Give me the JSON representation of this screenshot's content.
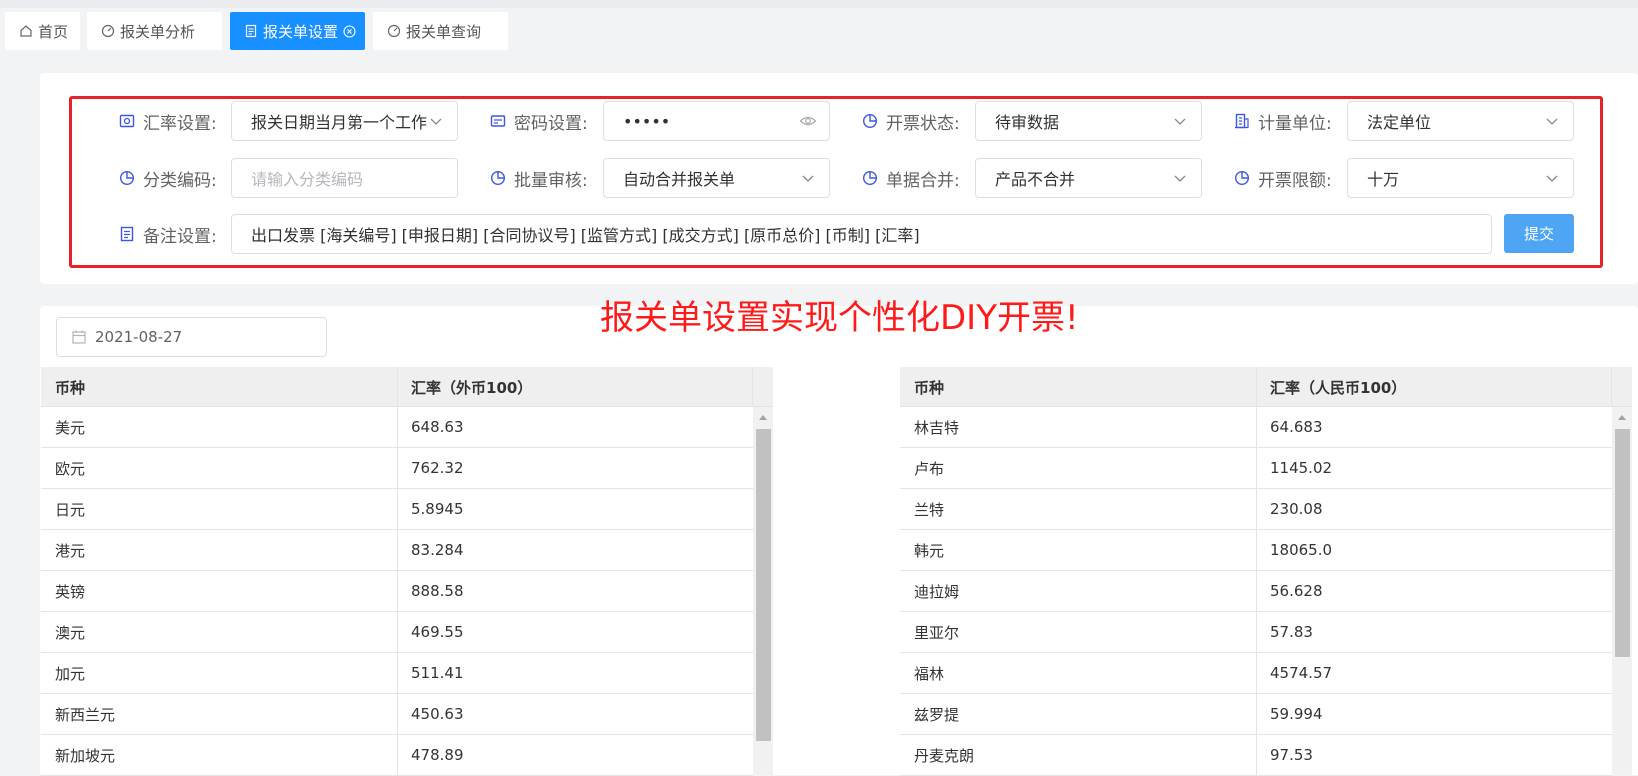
{
  "tabs": [
    {
      "label": "首页",
      "icon": "home-icon"
    },
    {
      "label": "报关单分析",
      "icon": "dashboard-icon"
    },
    {
      "label": "报关单设置",
      "icon": "document-icon",
      "active": true
    },
    {
      "label": "报关单查询",
      "icon": "dashboard-icon"
    }
  ],
  "settings": {
    "rate_label": "汇率设置:",
    "rate_value": "报关日期当月第一个工作日",
    "password_label": "密码设置:",
    "password_value": "•••••",
    "invoice_status_label": "开票状态:",
    "invoice_status_value": "待审数据",
    "unit_label": "计量单位:",
    "unit_value": "法定单位",
    "category_label": "分类编码:",
    "category_placeholder": "请输入分类编码",
    "batch_label": "批量审核:",
    "batch_value": "自动合并报关单",
    "merge_label": "单据合并:",
    "merge_value": "产品不合并",
    "limit_label": "开票限额:",
    "limit_value": "十万",
    "remark_label": "备注设置:",
    "remark_value": "出口发票 [海关编号] [申报日期] [合同协议号] [监管方式] [成交方式] [原币总价] [币制] [汇率]",
    "submit_label": "提交"
  },
  "annotation": "报关单设置实现个性化DIY开票!",
  "date": "2021-08-27",
  "colors": {
    "accent": "#1890ff",
    "annotation": "#ff1a1a",
    "highlight_box": "#e8222a"
  },
  "left_table": {
    "headers": [
      "币种",
      "汇率（外币100）"
    ],
    "rows": [
      [
        "美元",
        "648.63"
      ],
      [
        "欧元",
        "762.32"
      ],
      [
        "日元",
        "5.8945"
      ],
      [
        "港元",
        "83.284"
      ],
      [
        "英镑",
        "888.58"
      ],
      [
        "澳元",
        "469.55"
      ],
      [
        "加元",
        "511.41"
      ],
      [
        "新西兰元",
        "450.63"
      ],
      [
        "新加坡元",
        "478.89"
      ]
    ]
  },
  "right_table": {
    "headers": [
      "币种",
      "汇率（人民币100）"
    ],
    "rows": [
      [
        "林吉特",
        "64.683"
      ],
      [
        "卢布",
        "1145.02"
      ],
      [
        "兰特",
        "230.08"
      ],
      [
        "韩元",
        "18065.0"
      ],
      [
        "迪拉姆",
        "56.628"
      ],
      [
        "里亚尔",
        "57.83"
      ],
      [
        "福林",
        "4574.57"
      ],
      [
        "兹罗提",
        "59.994"
      ],
      [
        "丹麦克朗",
        "97.53"
      ]
    ]
  }
}
